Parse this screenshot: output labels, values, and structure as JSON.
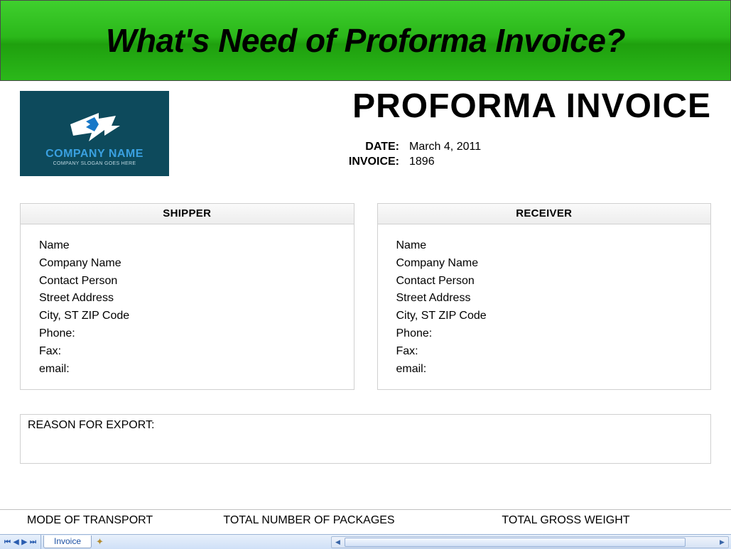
{
  "slide": {
    "title": "What's Need of Proforma Invoice?"
  },
  "logo": {
    "company_name": "COMPANY NAME",
    "slogan": "COMPANY SLOGAN GOES HERE"
  },
  "invoice": {
    "title": "PROFORMA INVOICE",
    "meta": {
      "date_label": "DATE:",
      "date_value": "March 4, 2011",
      "number_label": "INVOICE:",
      "number_value": "1896"
    }
  },
  "parties": {
    "shipper": {
      "header": "SHIPPER",
      "fields": [
        "Name",
        "Company Name",
        "Contact Person",
        "Street Address",
        "City, ST  ZIP Code",
        "Phone:",
        "Fax:",
        "email:"
      ]
    },
    "receiver": {
      "header": "RECEIVER",
      "fields": [
        "Name",
        "Company Name",
        "Contact Person",
        "Street Address",
        "City, ST  ZIP Code",
        "Phone:",
        "Fax:",
        "email:"
      ]
    }
  },
  "export_reason_label": "REASON FOR EXPORT:",
  "columns": {
    "c1": "MODE OF TRANSPORT",
    "c2": "TOTAL NUMBER OF PACKAGES",
    "c3": "TOTAL GROSS WEIGHT"
  },
  "workbook": {
    "active_tab": "Invoice"
  }
}
